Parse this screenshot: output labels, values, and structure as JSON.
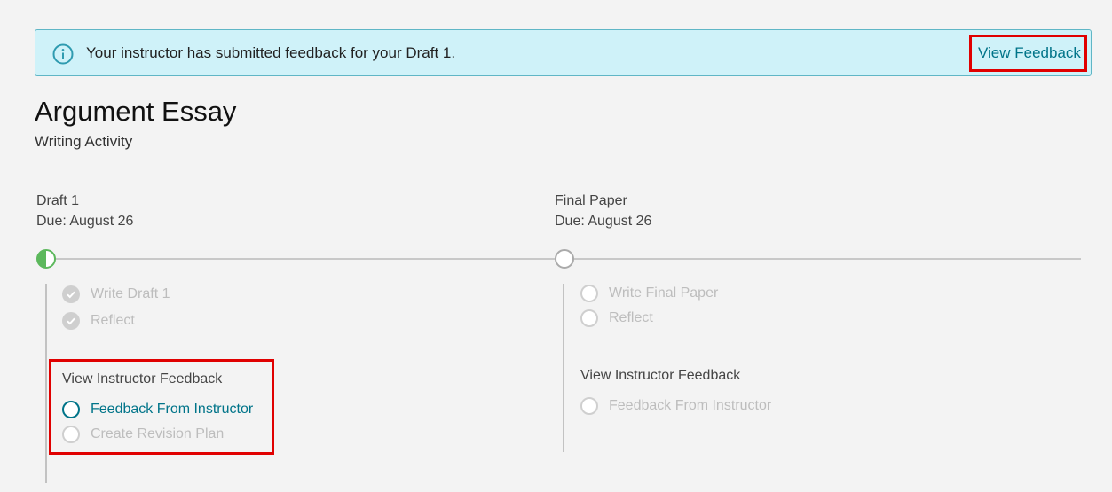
{
  "banner": {
    "message": "Your instructor has submitted feedback for your Draft 1.",
    "link_label": "View Feedback",
    "icon": "info-icon"
  },
  "activity": {
    "title": "Argument Essay",
    "subtitle": "Writing Activity"
  },
  "stages": [
    {
      "name": "Draft 1",
      "due": "Due: August 26",
      "status": "in-progress",
      "tasks": [
        {
          "label": "Write Draft 1",
          "state": "done"
        },
        {
          "label": "Reflect",
          "state": "done"
        }
      ],
      "group": {
        "title": "View Instructor Feedback",
        "tasks": [
          {
            "label": "Feedback From Instructor",
            "state": "active"
          },
          {
            "label": "Create Revision Plan",
            "state": "todo"
          }
        ]
      }
    },
    {
      "name": "Final Paper",
      "due": "Due: August 26",
      "status": "not-started",
      "tasks": [
        {
          "label": "Write Final Paper",
          "state": "todo"
        },
        {
          "label": "Reflect",
          "state": "todo"
        }
      ],
      "group": {
        "title": "View Instructor Feedback",
        "tasks": [
          {
            "label": "Feedback From Instructor",
            "state": "todo"
          }
        ]
      }
    }
  ],
  "colors": {
    "banner_bg": "#cff2f9",
    "link": "#007489",
    "progress": "#5cb85c",
    "highlight": "#e00000"
  }
}
